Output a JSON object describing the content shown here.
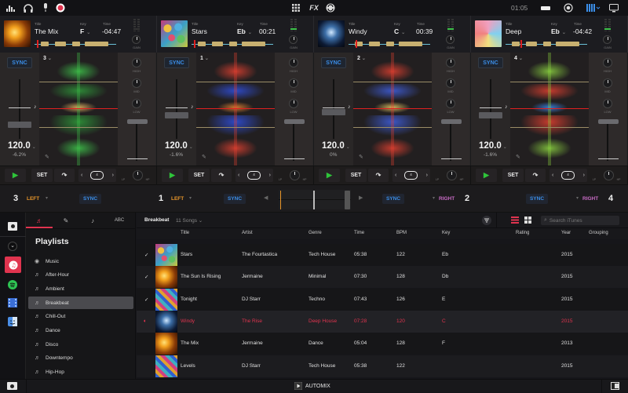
{
  "topbar": {
    "icons": [
      "mixer-icon",
      "headphones-icon",
      "microphone-icon",
      "record-icon",
      "grid-icon",
      "fx-label",
      "sync-icon",
      "keyboard-icon",
      "target-icon",
      "layout-icon",
      "display-icon"
    ],
    "fx_label": "FX",
    "clock": "01:05"
  },
  "decks": [
    {
      "pos": "1",
      "number": "3",
      "title": "The Mix",
      "key": "F",
      "time": "-04:47",
      "bpm": "120.0",
      "pitch": "-6.2%",
      "art": "fire"
    },
    {
      "pos": "2",
      "number": "1",
      "title": "Stars",
      "key": "Eb",
      "time": "00:21",
      "bpm": "120.0",
      "pitch": "-1.6%",
      "art": "bokeh"
    },
    {
      "pos": "3",
      "number": "2",
      "title": "Windy",
      "key": "C",
      "time": "00:39",
      "bpm": "120.0",
      "pitch": "0%",
      "art": "blue"
    },
    {
      "pos": "4",
      "number": "4",
      "title": "Deep",
      "key": "Eb",
      "time": "-04:42",
      "bpm": "120.0",
      "pitch": "-1.6%",
      "art": "triangle"
    }
  ],
  "labels": {
    "title": "Title",
    "key": "Key",
    "time": "Time",
    "gain": "GAIN",
    "sync": "SYNC",
    "set": "SET",
    "high": "HIGH",
    "mid": "MID",
    "low": "LOW",
    "lp": "LP",
    "hp": "HP",
    "loop_size": "4"
  },
  "mixer": {
    "left_decks": [
      {
        "num": "3",
        "side": "LEFT"
      },
      {
        "num": "1",
        "side": "LEFT"
      }
    ],
    "right_decks": [
      {
        "num": "2",
        "side": "RIGHT"
      },
      {
        "num": "4",
        "side": "RIGHT"
      }
    ],
    "sync": "SYNC",
    "crossfader_position": 0.5
  },
  "library": {
    "tabs": [
      "playlists-tab",
      "microphone-tab",
      "music-file-tab",
      "abc-tab"
    ],
    "heading": "Playlists",
    "playlists": [
      "Music",
      "After-Hour",
      "Ambient",
      "Breakbeat",
      "Chill-Out",
      "Dance",
      "Disco",
      "Downtempo",
      "Hip-Hop"
    ],
    "selected_playlist": "Breakbeat",
    "current_name": "Breakbeat",
    "song_count": "11 Songs",
    "search_placeholder": "Search iTunes",
    "columns": [
      "Title",
      "Artist",
      "Genre",
      "Time",
      "BPM",
      "Key",
      "Rating",
      "Year",
      "Grouping"
    ],
    "rows": [
      {
        "check": "✓",
        "title": "Stars",
        "artist": "The Fourtastica",
        "genre": "Tech House",
        "time": "05:38",
        "bpm": "122",
        "key": "Eb",
        "rating": "",
        "year": "2015",
        "grouping": "",
        "art": "bokeh",
        "playing": false
      },
      {
        "check": "✓",
        "title": "The Sun Is Rising",
        "artist": "Jermaine",
        "genre": "Minimal",
        "time": "07:30",
        "bpm": "128",
        "key": "Db",
        "rating": "",
        "year": "2015",
        "grouping": "",
        "art": "fire",
        "playing": false
      },
      {
        "check": "✓",
        "title": "Tonight",
        "artist": "DJ Starr",
        "genre": "Techno",
        "time": "07:43",
        "bpm": "126",
        "key": "E",
        "rating": "",
        "year": "2015",
        "grouping": "",
        "art": "mosaic",
        "playing": false
      },
      {
        "check": "",
        "title": "Windy",
        "artist": "The Rise",
        "genre": "Deep House",
        "time": "07:28",
        "bpm": "120",
        "key": "C",
        "rating": "",
        "year": "2015",
        "grouping": "",
        "art": "blue",
        "playing": true
      },
      {
        "check": "",
        "title": "The Mix",
        "artist": "Jermaine",
        "genre": "Dance",
        "time": "05:04",
        "bpm": "128",
        "key": "F",
        "rating": "",
        "year": "2013",
        "grouping": "",
        "art": "fire",
        "playing": false
      },
      {
        "check": "",
        "title": "Levels",
        "artist": "DJ Starr",
        "genre": "Tech House",
        "time": "05:38",
        "bpm": "122",
        "key": "",
        "rating": "",
        "year": "2015",
        "grouping": "",
        "art": "mosaic",
        "playing": false
      }
    ]
  },
  "footer": {
    "automix": "AUTOMIX"
  },
  "colors": {
    "accent_blue": "#3b8ee8",
    "left_orange": "#e8962a",
    "right_purple": "#c76bc4",
    "playing_red": "#e0344f",
    "play_green": "#2fc43a"
  }
}
